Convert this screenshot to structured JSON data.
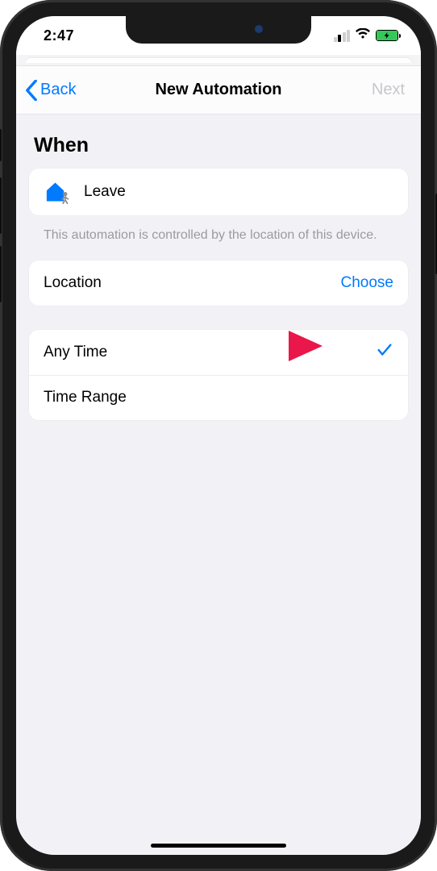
{
  "status": {
    "time": "2:47"
  },
  "nav": {
    "back": "Back",
    "title": "New Automation",
    "next": "Next"
  },
  "section": {
    "header": "When"
  },
  "trigger": {
    "label": "Leave"
  },
  "footnote": "This automation is controlled by the location of this device.",
  "location": {
    "label": "Location",
    "action": "Choose"
  },
  "time": {
    "any": "Any Time",
    "range": "Time Range"
  },
  "colors": {
    "accent": "#007aff",
    "annotation": "#e9174a"
  }
}
